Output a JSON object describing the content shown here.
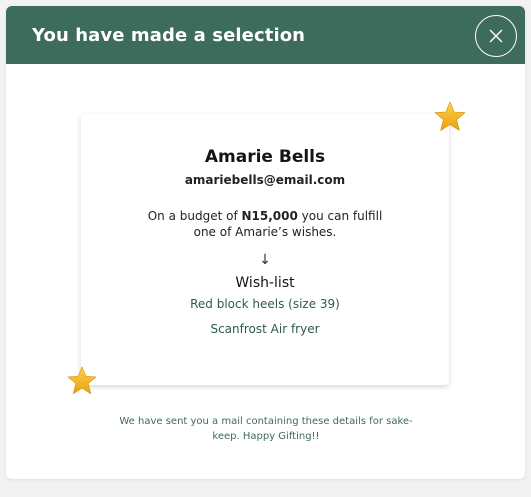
{
  "header": {
    "title": "You have made a selection",
    "close_icon": "close-icon"
  },
  "recipient": {
    "name": "Amarie Bells",
    "email": "amariebells@email.com"
  },
  "budget": {
    "prefix": "On a budget of ",
    "amount": "N15,000",
    "suffix": " you can fulfill one of Amarie’s wishes."
  },
  "arrow": "↓",
  "wishlist": {
    "title": "Wish-list",
    "items": [
      "Red block heels (size 39)",
      "Scanfrost Air fryer"
    ]
  },
  "footer": {
    "note": "We have sent you a mail containing these details for sake-keep. Happy Gifting!!"
  },
  "colors": {
    "header_bg": "#3d6b5c",
    "accent_green": "#2f5a4b",
    "star": "#f2b31b"
  }
}
